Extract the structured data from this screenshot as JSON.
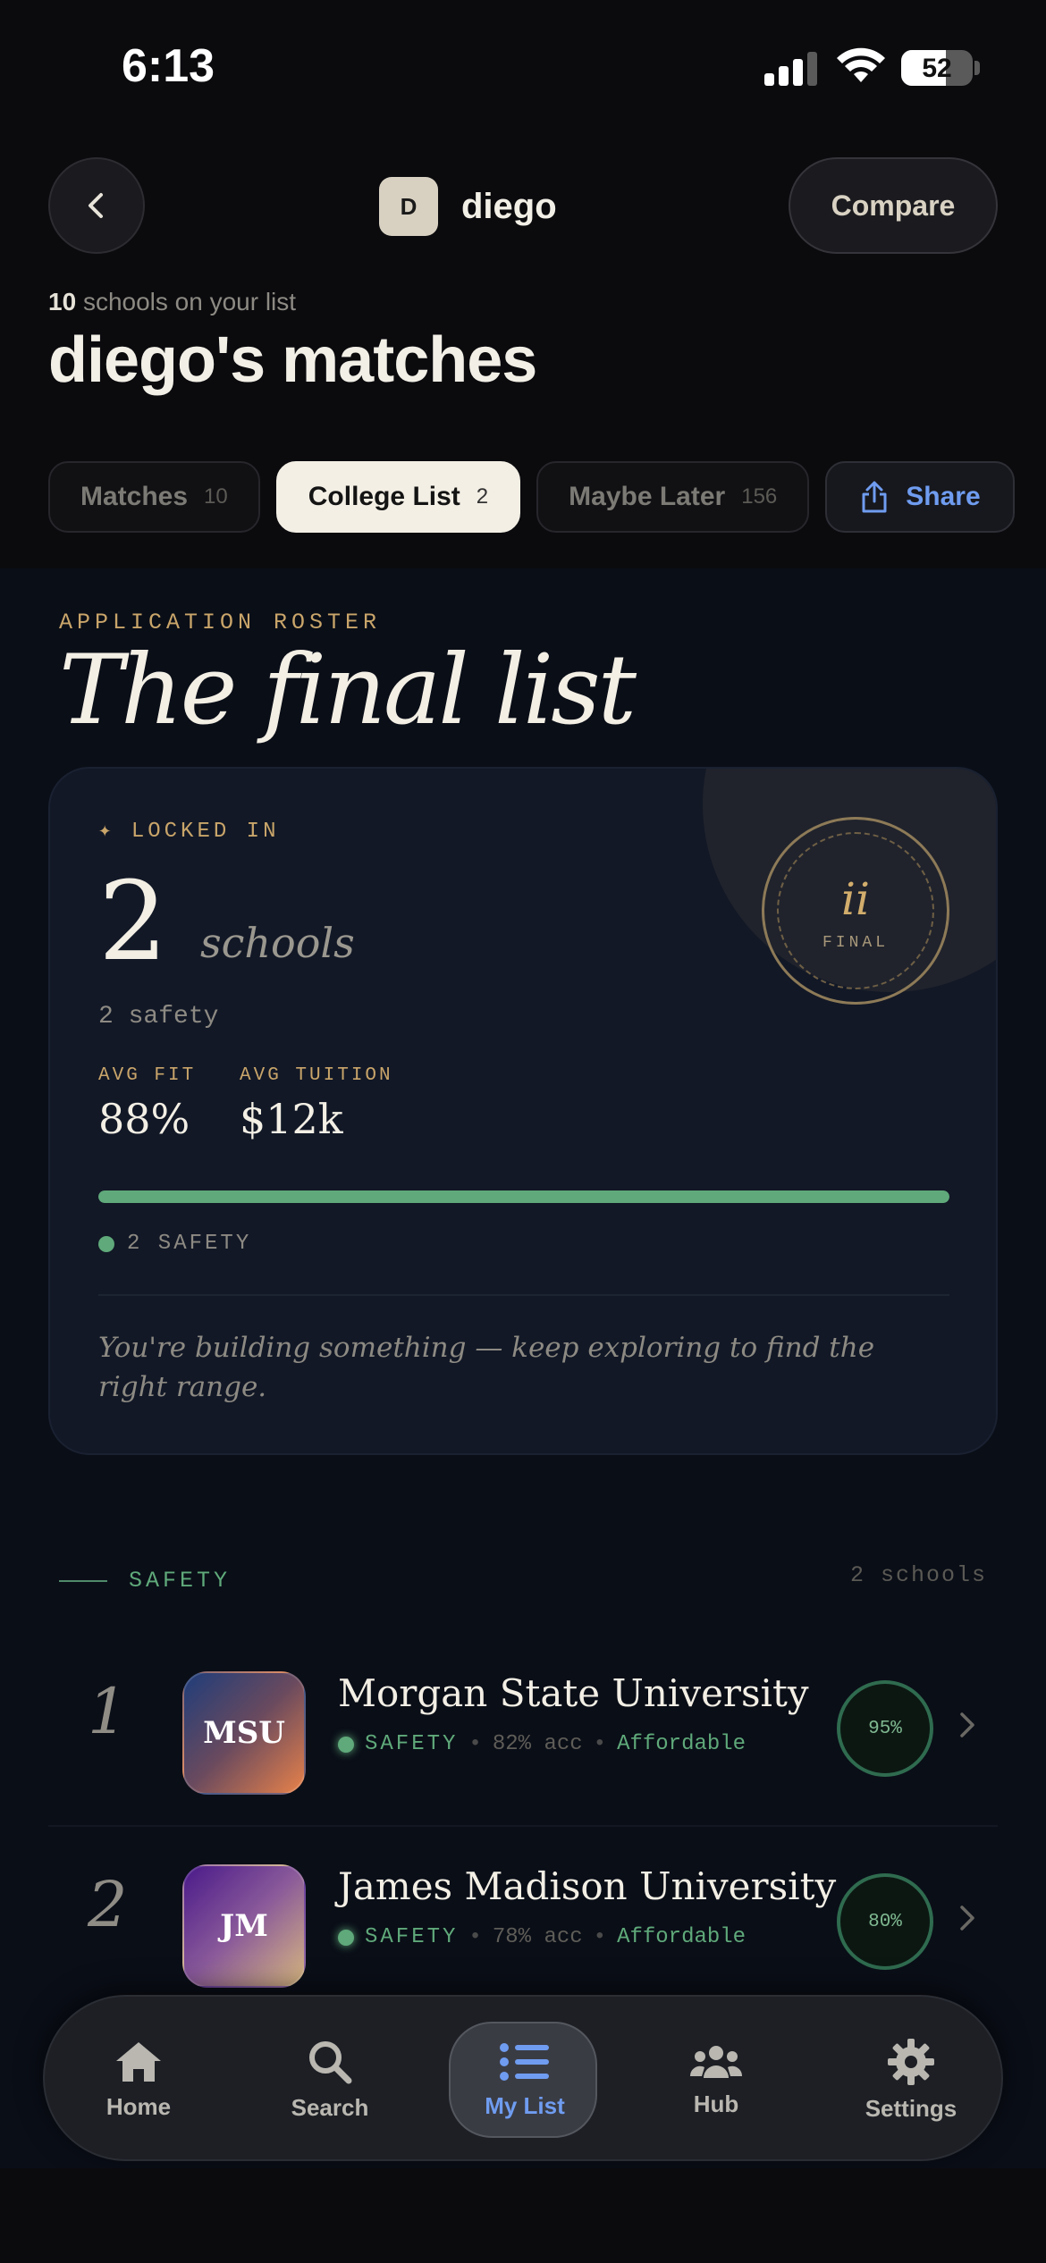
{
  "status": {
    "time": "6:13",
    "battery": "52"
  },
  "header": {
    "avatar_initial": "D",
    "username": "diego",
    "compare_label": "Compare",
    "count_number": "10",
    "count_text": "schools on your list",
    "title": "diego's matches"
  },
  "tabs": [
    {
      "label": "Matches",
      "count": "10"
    },
    {
      "label": "College List",
      "count": "2"
    },
    {
      "label": "Maybe Later",
      "count": "156"
    }
  ],
  "share_label": "Share",
  "roster": {
    "eyebrow": "APPLICATION ROSTER",
    "title": "The final list"
  },
  "summary": {
    "locked_label": "✦  LOCKED IN",
    "count": "2",
    "unit": "schools",
    "sub": "2 safety",
    "avg_fit_label": "AVG FIT",
    "avg_fit": "88%",
    "avg_tuition_label": "AVG TUITION",
    "avg_tuition": "$12k",
    "safety_fraction": 1.0,
    "legend": "2 SAFETY",
    "note": "You're building something — keep exploring to find the right range.",
    "seal_numeral": "ii",
    "seal_word": "FINAL"
  },
  "section": {
    "label": "SAFETY",
    "count": "2 schools"
  },
  "schools": [
    {
      "rank": "1",
      "logo": "MSU",
      "name": "Morgan State University",
      "tier": "SAFETY",
      "acceptance": "82% acc",
      "cost": "Affordable",
      "fit": "95%"
    },
    {
      "rank": "2",
      "logo": "JM",
      "name": "James Madison University",
      "tier": "SAFETY",
      "acceptance": "78% acc",
      "cost": "Affordable",
      "fit": "80%"
    }
  ],
  "colors": {
    "accent": "#6f9cf0",
    "gold": "#c9a56a",
    "safety": "#5fa97a"
  },
  "nav": [
    {
      "label": "Home",
      "icon": "home-icon"
    },
    {
      "label": "Search",
      "icon": "search-icon"
    },
    {
      "label": "My List",
      "icon": "list-icon"
    },
    {
      "label": "Hub",
      "icon": "people-icon"
    },
    {
      "label": "Settings",
      "icon": "gear-icon"
    }
  ]
}
